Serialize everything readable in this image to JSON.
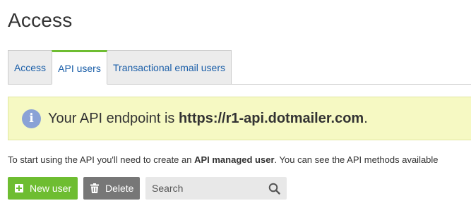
{
  "page": {
    "title": "Access"
  },
  "tabs": [
    {
      "label": "Access",
      "active": false
    },
    {
      "label": "API users",
      "active": true
    },
    {
      "label": "Transactional email users",
      "active": false
    }
  ],
  "notice": {
    "icon": "info-icon",
    "text_prefix": "Your API endpoint is ",
    "url": "https://r1-api.dotmailer.com",
    "text_suffix": "."
  },
  "intro": {
    "before": "To start using the API you'll need to create an ",
    "bold": "API managed user",
    "after": ". You can see the API methods available"
  },
  "toolbar": {
    "new_user_label": "New user",
    "delete_label": "Delete",
    "search_placeholder": "Search"
  },
  "colors": {
    "accent_green": "#6ebd31",
    "link_blue": "#1a5ea8",
    "notice_bg": "#f6f9c3",
    "delete_gray": "#777777"
  }
}
